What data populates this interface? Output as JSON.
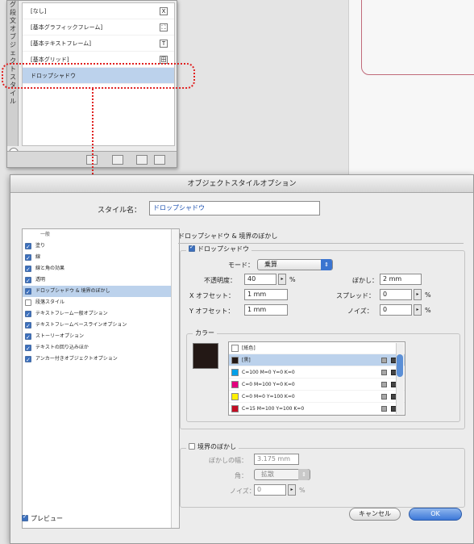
{
  "panel": {
    "tabs": [
      "グ",
      "段",
      "文",
      "オ",
      "ブ",
      "ジ",
      "ェ",
      "ク",
      "ト",
      "ス",
      "タ",
      "イ",
      "ル"
    ],
    "items": [
      {
        "label": "[なし]",
        "icon": "X"
      },
      {
        "label": "[基本グラフィックフレーム]",
        "icon": "⛶"
      },
      {
        "label": "[基本テキストフレーム]",
        "icon": "T"
      },
      {
        "label": "[基本グリッド]",
        "icon": "田"
      },
      {
        "label": "ドロップシャドウ",
        "icon": ""
      }
    ]
  },
  "dialog": {
    "title": "オブジェクトスタイルオプション",
    "style_name_label": "スタイル名：",
    "style_name_value": "ドロップシャドウ",
    "left_group": "一般",
    "left_items": [
      {
        "label": "塗り",
        "checked": true
      },
      {
        "label": "線",
        "checked": true
      },
      {
        "label": "線と角の効果",
        "checked": true
      },
      {
        "label": "透明",
        "checked": true
      },
      {
        "label": "ドロップシャドウ & 境界のぼかし",
        "checked": true
      },
      {
        "label": "段落スタイル",
        "checked": false
      },
      {
        "label": "テキストフレーム一般オプション",
        "checked": true
      },
      {
        "label": "テキストフレームベースラインオプション",
        "checked": true
      },
      {
        "label": "ストーリーオプション",
        "checked": true
      },
      {
        "label": "テキストの回り込みほか",
        "checked": true
      },
      {
        "label": "アンカー付きオブジェクトオプション",
        "checked": true
      }
    ],
    "right_title": "ドロップシャドウ & 境界のぼかし",
    "drop_shadow_label": "ドロップシャドウ",
    "mode_label": "モード：",
    "mode_value": "乗算",
    "opacity_label": "不透明度：",
    "opacity_value": "40",
    "opacity_unit": "%",
    "blur_label": "ぼかし：",
    "blur_value": "2 mm",
    "x_offset_label": "X オフセット：",
    "x_offset_value": "1 mm",
    "spread_label": "スプレッド：",
    "spread_value": "0",
    "spread_unit": "%",
    "y_offset_label": "Y オフセット：",
    "y_offset_value": "1 mm",
    "noise_label": "ノイズ：",
    "noise_value": "0",
    "noise_unit": "%",
    "color_label": "カラー",
    "swatches": [
      {
        "label": "[紙色]",
        "color": "#ffffff"
      },
      {
        "label": "[黒]",
        "color": "#231815"
      },
      {
        "label": "C=100 M=0 Y=0 K=0",
        "color": "#00a0e9"
      },
      {
        "label": "C=0 M=100 Y=0 K=0",
        "color": "#e4007f"
      },
      {
        "label": "C=0 M=0 Y=100 K=0",
        "color": "#fff100"
      },
      {
        "label": "C=15 M=100 Y=100 K=0",
        "color": "#c30d23"
      }
    ],
    "feather_label": "境界のぼかし",
    "feather_width_label": "ぼかしの幅：",
    "feather_width_value": "3.175 mm",
    "corner_label": "角：",
    "corner_value": "拡散",
    "feather_noise_label": "ノイズ：",
    "feather_noise_value": "0",
    "feather_noise_unit": "%",
    "preview_label": "プレビュー",
    "cancel_label": "キャンセル",
    "ok_label": "OK"
  }
}
